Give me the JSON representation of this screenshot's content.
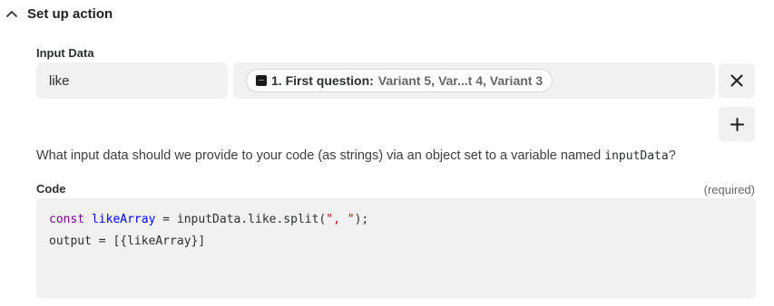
{
  "section": {
    "title": "Set up action",
    "chevron_icon": "chevron-up-icon"
  },
  "input_data": {
    "label": "Input Data",
    "key_value": "like",
    "token": {
      "step_label": "1. First question:",
      "values_label": "Variant 5,  Var...t 4,  Variant 3"
    },
    "remove_icon": "close-icon",
    "add_icon": "plus-icon"
  },
  "help": {
    "text_before": "What input data should we provide to your code (as strings) via an object set to a variable named ",
    "code": "inputData",
    "text_after": "?"
  },
  "code_field": {
    "label": "Code",
    "required_text": "(required)",
    "line1": {
      "keyword": "const",
      "variable": "likeArray",
      "middle": " = inputData.like.split(",
      "string": "\", \"",
      "end": ");"
    },
    "line2": "output = [{likeArray}]"
  },
  "colors": {
    "field_bg": "#f1f1f1",
    "keyword": "#770088",
    "variable": "#0000ff",
    "string": "#aa1111"
  }
}
